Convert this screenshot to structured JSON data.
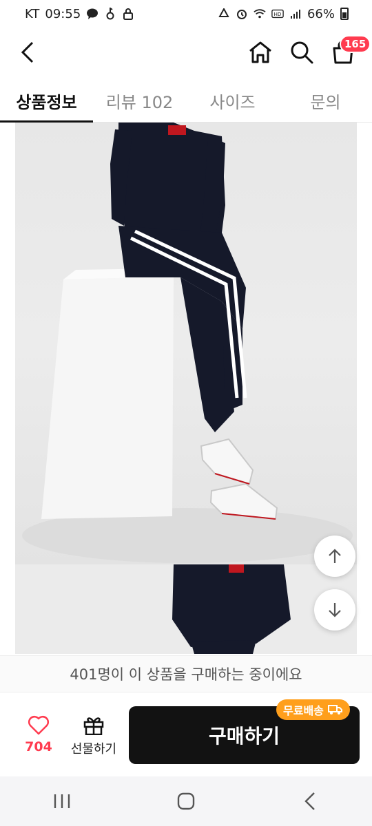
{
  "status_bar": {
    "carrier": "KT",
    "time": "09:55",
    "battery": "66%",
    "left_icons": [
      "chat-icon",
      "key-icon",
      "lock-icon"
    ],
    "right_icons": [
      "recycle-icon",
      "alarm-icon",
      "wifi-icon",
      "hd-icon",
      "signal-icon",
      "battery-icon"
    ]
  },
  "header": {
    "cart_badge": "165",
    "icons": [
      "back-icon",
      "home-icon",
      "search-icon",
      "cart-icon"
    ]
  },
  "tabs": [
    {
      "label": "상품정보",
      "active": true
    },
    {
      "label": "리뷰 102",
      "active": false
    },
    {
      "label": "사이즈",
      "active": false
    },
    {
      "label": "문의",
      "active": false
    }
  ],
  "notice": "401명이 이 상품을 구매하는 중이에요",
  "action_bar": {
    "like_count": "704",
    "gift_label": "선물하기",
    "buy_label": "구매하기",
    "free_shipping": "무료배송"
  },
  "colors": {
    "accent": "#ff3b4f",
    "buy_button": "#121212",
    "free_shipping_badge": "#ff9f1c"
  }
}
